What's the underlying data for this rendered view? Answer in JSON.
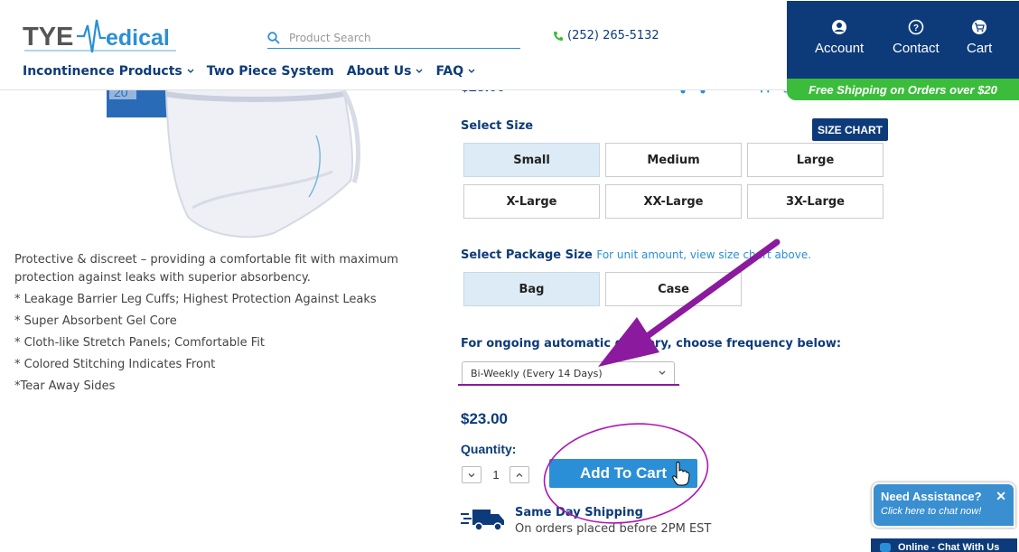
{
  "header": {
    "logo_text": "TYE Medical",
    "search_placeholder": "Product Search",
    "phone": "(252) 265-5132",
    "nav": [
      "Incontinence Products",
      "Two Piece System",
      "About Us",
      "FAQ"
    ],
    "account": [
      "Account",
      "Contact",
      "Cart"
    ],
    "free_shipping_banner": "Free Shipping on Orders over $20"
  },
  "product": {
    "price_partial": "$23.00",
    "shipping_partial": "Free Shipping",
    "description": "Protective & discreet – providing a comfortable fit with maximum protection against leaks with superior absorbency.",
    "bullets": [
      "* Leakage Barrier Leg Cuffs; Highest Protection Against Leaks",
      "* Super Absorbent Gel Core",
      "* Cloth-like Stretch Panels; Comfortable Fit",
      "* Colored Stitching Indicates Front",
      "*Tear Away Sides"
    ],
    "select_size_label": "Select Size",
    "size_chart_label": "SIZE CHART",
    "sizes": [
      "Small",
      "Medium",
      "Large",
      "X-Large",
      "XX-Large",
      "3X-Large"
    ],
    "selected_size": "Small",
    "package_label": "Select Package Size",
    "package_note": "For unit amount, view size chart above.",
    "packages": [
      "Bag",
      "Case"
    ],
    "selected_package": "Bag",
    "frequency_label": "For ongoing automatic delivery, choose frequency below:",
    "frequency_value": "Bi-Weekly (Every 14 Days)",
    "price": "$23.00",
    "quantity_label": "Quantity:",
    "quantity": "1",
    "add_to_cart": "Add To Cart",
    "same_day_title": "Same Day Shipping",
    "same_day_sub": "On orders placed before 2PM EST"
  },
  "chat": {
    "title": "Need Assistance?",
    "subtitle": "Click here to chat now!",
    "tab": "Online - Chat With Us"
  },
  "colors": {
    "brand_navy": "#0d3b7a",
    "accent_blue": "#2a8fd6",
    "banner_green": "#3bbd3b",
    "annotation_purple": "#8b1a9e"
  }
}
